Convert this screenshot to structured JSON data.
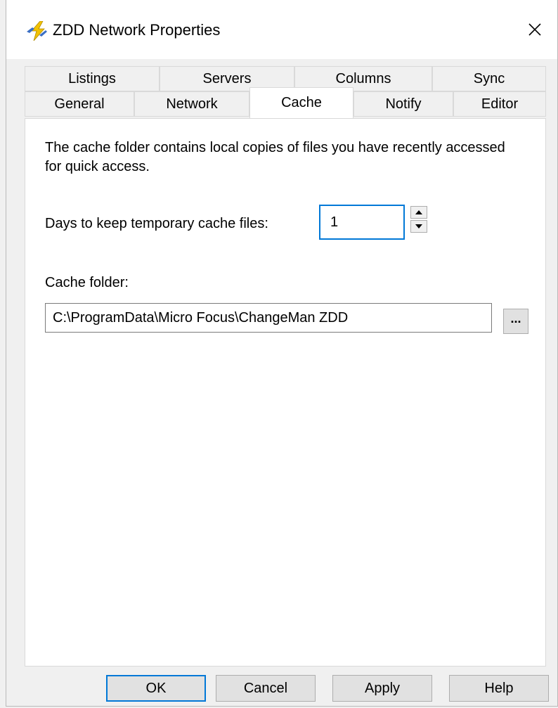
{
  "window": {
    "title": "ZDD Network Properties",
    "app_icon": "lightning-bolt-icon"
  },
  "tabs": {
    "row1": [
      {
        "label": "Listings"
      },
      {
        "label": "Servers"
      },
      {
        "label": "Columns"
      },
      {
        "label": "Sync"
      }
    ],
    "row2": [
      {
        "label": "General"
      },
      {
        "label": "Network"
      },
      {
        "label": "Cache",
        "active": true
      },
      {
        "label": "Notify"
      },
      {
        "label": "Editor"
      }
    ]
  },
  "cache": {
    "description": "The cache folder contains local copies of files you have recently accessed for quick access.",
    "days_label": "Days to keep temporary cache files:",
    "days_value": "1",
    "folder_label": "Cache folder:",
    "folder_value": "C:\\ProgramData\\Micro Focus\\ChangeMan ZDD",
    "browse_label": "..."
  },
  "buttons": {
    "ok": "OK",
    "cancel": "Cancel",
    "apply": "Apply",
    "help": "Help"
  },
  "colors": {
    "accent": "#0078d7",
    "icon_yellow": "#f2c200",
    "icon_blue": "#3b6fc4"
  }
}
